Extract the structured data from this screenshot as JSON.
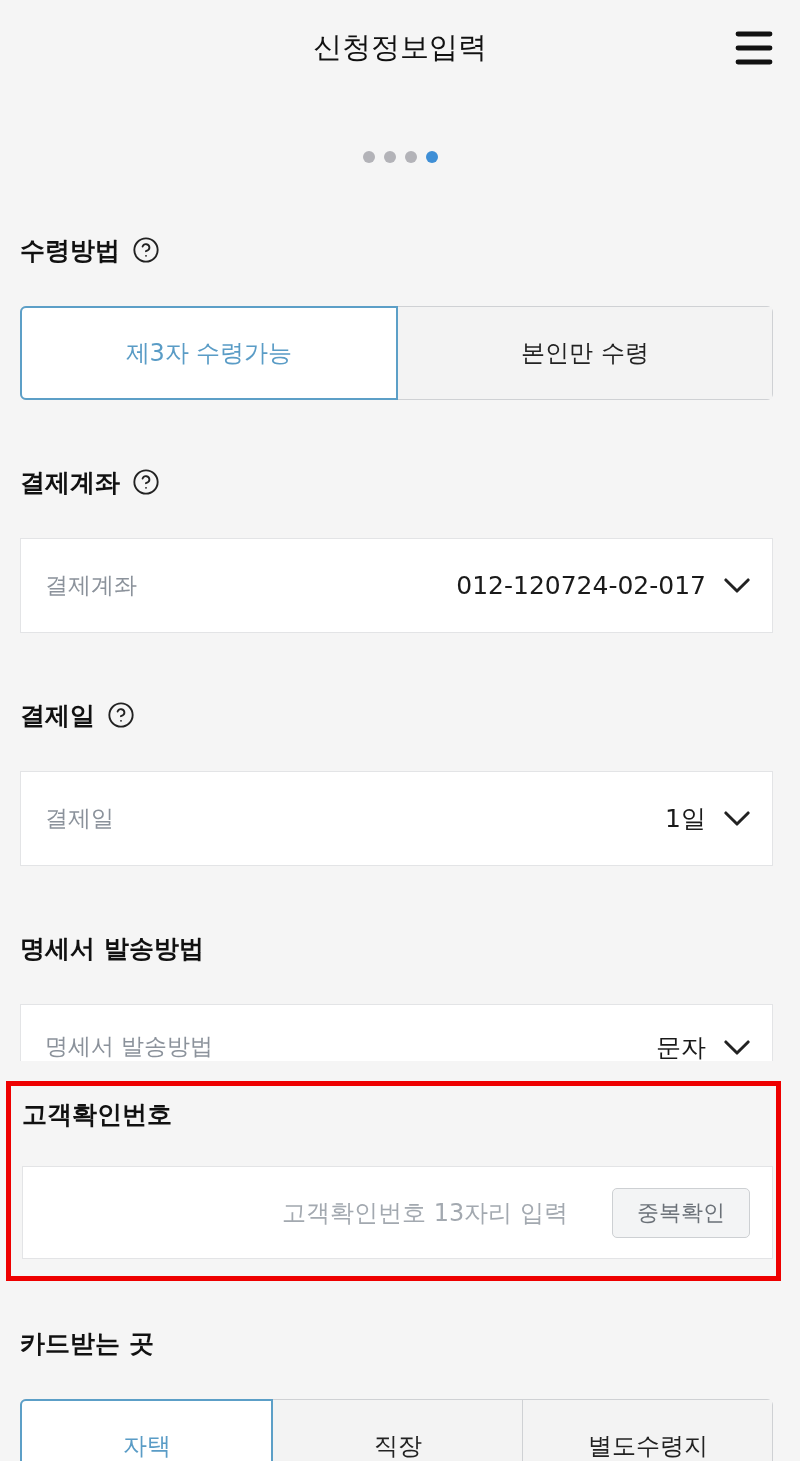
{
  "header": {
    "title": "신청정보입력"
  },
  "steps": [
    {
      "selected": false
    },
    {
      "selected": false
    },
    {
      "selected": false
    },
    {
      "selected": true
    }
  ],
  "sections": [
    {
      "kind": "segmented",
      "label": "수령방법",
      "help": true,
      "highlighted": false,
      "options": [
        {
          "label": "제3자 수령가능",
          "selected": true
        },
        {
          "label": "본인만 수령",
          "selected": false
        }
      ]
    },
    {
      "kind": "select",
      "label": "결제계좌",
      "help": true,
      "highlighted": false,
      "field_label": "결제계좌",
      "value": "012-120724-02-017"
    },
    {
      "kind": "select",
      "label": "결제일",
      "help": true,
      "highlighted": false,
      "field_label": "결제일",
      "value": "1일"
    },
    {
      "kind": "select",
      "label": "명세서 발송방법",
      "help": false,
      "highlighted": false,
      "field_label": "명세서 발송방법",
      "value": "문자"
    },
    {
      "kind": "input",
      "label": "고객확인번호",
      "help": false,
      "highlighted": true,
      "placeholder": "고객확인번호 13자리 입력",
      "button": "중복확인"
    },
    {
      "kind": "segmented",
      "label": "카드받는 곳",
      "help": false,
      "highlighted": false,
      "options": [
        {
          "label": "자택",
          "selected": true
        },
        {
          "label": "직장",
          "selected": false
        },
        {
          "label": "별도수령지",
          "selected": false
        }
      ]
    }
  ]
}
